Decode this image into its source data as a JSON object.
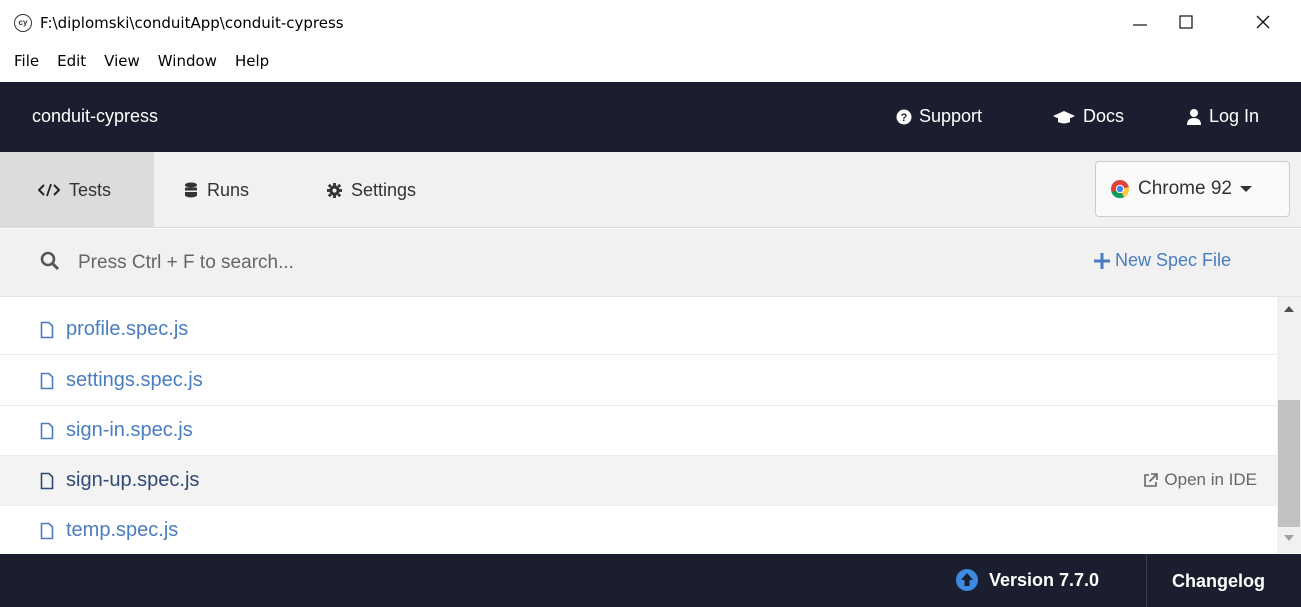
{
  "window": {
    "title": "F:\\diplomski\\conduitApp\\conduit-cypress",
    "app_icon_text": "cy",
    "minimize_icon": "minimize-icon",
    "maximize_icon": "maximize-icon",
    "close_icon": "close-icon"
  },
  "menu": [
    "File",
    "Edit",
    "View",
    "Window",
    "Help"
  ],
  "header": {
    "project": "conduit-cypress",
    "support": "Support",
    "docs": "Docs",
    "login": "Log In"
  },
  "nav": {
    "tests": "Tests",
    "runs": "Runs",
    "settings": "Settings",
    "browser": "Chrome 92"
  },
  "search": {
    "placeholder": "Press Ctrl + F to search...",
    "new_spec": "New Spec File"
  },
  "specs": [
    {
      "name": "profile.spec.js"
    },
    {
      "name": "settings.spec.js"
    },
    {
      "name": "sign-in.spec.js"
    },
    {
      "name": "sign-up.spec.js",
      "hovered": true,
      "action": "Open in IDE"
    },
    {
      "name": "temp.spec.js"
    }
  ],
  "footer": {
    "version": "Version 7.7.0",
    "changelog": "Changelog"
  },
  "colors": {
    "header_bg": "#1b1e2e",
    "link_blue": "#4a7dbf",
    "update_icon": "#3d8be0"
  }
}
